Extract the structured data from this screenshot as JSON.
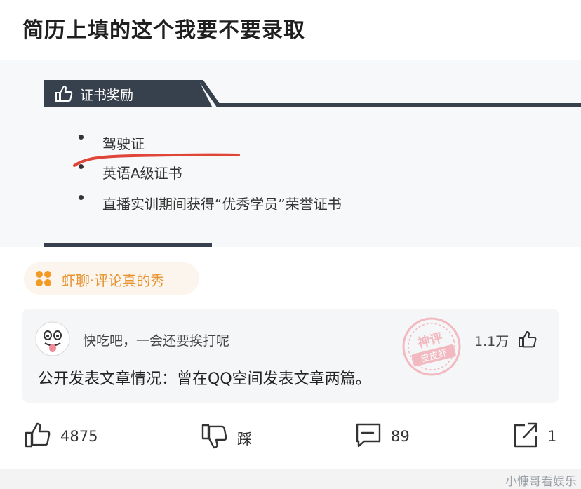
{
  "post": {
    "title": "简历上填的这个我要不要录取"
  },
  "resume": {
    "section_title": "证书奖励",
    "items": [
      "驾驶证",
      "英语A级证书",
      "直播实训期间获得“优秀学员”荣誉证书"
    ]
  },
  "topic": {
    "label": "虾聊·评论真的秀"
  },
  "comment": {
    "user": "快吃吧，一会还要挨打呢",
    "likes": "1.1万",
    "text": "公开发表文章情况：曾在QQ空间发表文章两篇。",
    "stamp_line1": "神评",
    "stamp_line2": "皮皮虾"
  },
  "actions": {
    "like_count": "4875",
    "dislike_label": "踩",
    "comment_count": "89",
    "share_count": "1"
  },
  "watermark": "小慷哥看娱乐",
  "colors": {
    "topic_text": "#e8932f",
    "topic_bg": "#fbf5ee",
    "section_bar": "#37414d",
    "underline": "#e0453a",
    "stamp": "#f08a94"
  }
}
